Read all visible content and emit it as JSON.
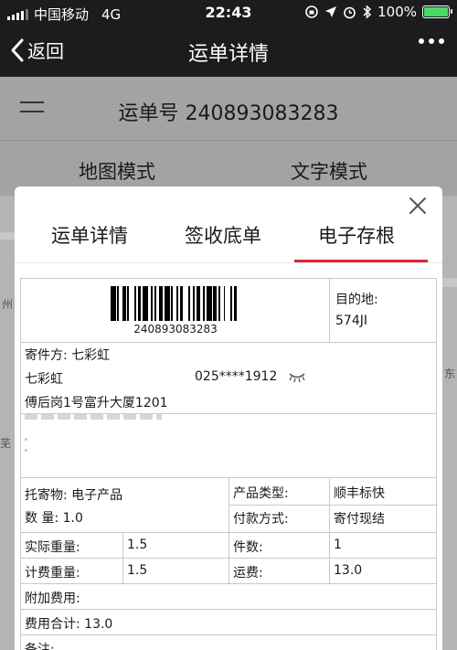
{
  "status_bar": {
    "carrier": "中国移动",
    "network": "4G",
    "time": "22:43",
    "battery": "100%"
  },
  "nav": {
    "back_label": "返回",
    "title": "运单详情"
  },
  "background": {
    "waybill_label": "运单号 240893083283",
    "mode_tabs": [
      "地图模式",
      "文字模式"
    ],
    "map_labels": [
      "州",
      "东",
      "芜"
    ]
  },
  "modal": {
    "tabs": [
      "运单详情",
      "签收底单",
      "电子存根"
    ],
    "active_tab": 2,
    "accent_color": "#d9273a"
  },
  "receipt": {
    "barcode_number": "240893083283",
    "destination_label": "目的地:",
    "destination_value": "574JI",
    "sender": {
      "label": "寄件方: 七彩虹",
      "name": "七彩虹",
      "phone": "025****1912",
      "address": "傅后岗1号富升大厦1201"
    },
    "goods_label": "托寄物: 电子产品",
    "quantity_label": "数    量:  1.0",
    "product_type_label": "产品类型:",
    "product_type_value": "顺丰标快",
    "payment_label": "付款方式:",
    "payment_value": "寄付现结",
    "actual_weight_label": "实际重量:",
    "actual_weight_value": "1.5",
    "pieces_label": "件数:",
    "pieces_value": "1",
    "billed_weight_label": "计费重量:",
    "billed_weight_value": "1.5",
    "freight_label": "运费:",
    "freight_value": "13.0",
    "extra_fee_label": "附加费用:",
    "total_label": "费用合计: 13.0",
    "remark_label": "备注:"
  }
}
